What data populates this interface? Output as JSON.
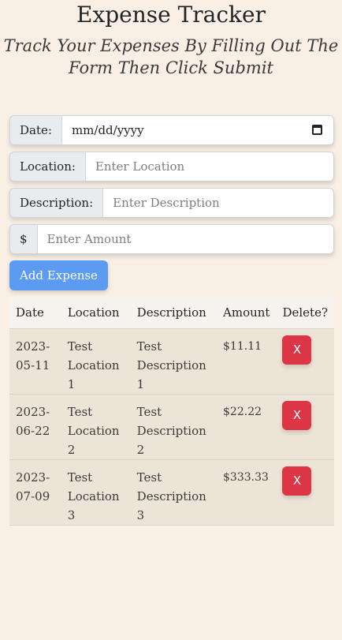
{
  "header": {
    "title": "Expense Tracker",
    "subtitle": "Track Your Expenses By Filling Out The Form Then Click Submit"
  },
  "form": {
    "date_label": "Date:",
    "date_placeholder": "mm/dd/yyyy",
    "location_label": "Location:",
    "location_placeholder": "Enter Location",
    "description_label": "Description:",
    "description_placeholder": "Enter Description",
    "amount_label": "$",
    "amount_placeholder": "Enter Amount",
    "submit_label": "Add Expense"
  },
  "table": {
    "headers": [
      "Date",
      "Location",
      "Description",
      "Amount",
      "Delete?"
    ],
    "rows": [
      {
        "date": "2023-05-11",
        "location": "Test Location 1",
        "description": "Test Description 1",
        "amount": "$11.11",
        "delete_label": "X"
      },
      {
        "date": "2023-06-22",
        "location": "Test Location 2",
        "description": "Test Description 2",
        "amount": "$22.22",
        "delete_label": "X"
      },
      {
        "date": "2023-07-09",
        "location": "Test Location 3",
        "description": "Test Description 3",
        "amount": "$333.33",
        "delete_label": "X"
      }
    ]
  },
  "colors": {
    "background": "#f9efe5",
    "primary": "#5b9cf2",
    "danger": "#dc3545"
  }
}
